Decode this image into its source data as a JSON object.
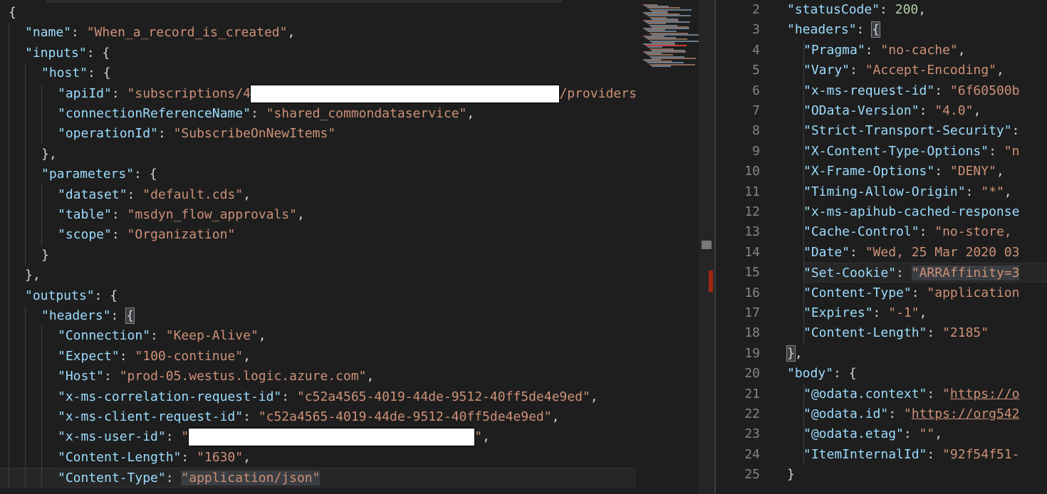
{
  "left_editor": {
    "lines": [
      [
        [
          "p",
          "{"
        ]
      ],
      [
        [
          "k",
          "\"name\""
        ],
        [
          "p",
          ": "
        ],
        [
          "s",
          "\"When_a_record_is_created\""
        ],
        [
          "p",
          ","
        ]
      ],
      [
        [
          "k",
          "\"inputs\""
        ],
        [
          "p",
          ": {"
        ]
      ],
      [
        [
          "k",
          "\"host\""
        ],
        [
          "p",
          ": {"
        ]
      ],
      [
        [
          "k",
          "\"apiId\""
        ],
        [
          "p",
          ": "
        ],
        [
          "s",
          "\"subscriptions/4"
        ],
        [
          "r",
          "                                        "
        ],
        [
          "s",
          "/providers/"
        ]
      ],
      [
        [
          "k",
          "\"connectionReferenceName\""
        ],
        [
          "p",
          ": "
        ],
        [
          "s",
          "\"shared_commondataservice\""
        ],
        [
          "p",
          ","
        ]
      ],
      [
        [
          "k",
          "\"operationId\""
        ],
        [
          "p",
          ": "
        ],
        [
          "s",
          "\"SubscribeOnNewItems\""
        ]
      ],
      [
        [
          "p",
          "},"
        ]
      ],
      [
        [
          "k",
          "\"parameters\""
        ],
        [
          "p",
          ": {"
        ]
      ],
      [
        [
          "k",
          "\"dataset\""
        ],
        [
          "p",
          ": "
        ],
        [
          "s",
          "\"default.cds\""
        ],
        [
          "p",
          ","
        ]
      ],
      [
        [
          "k",
          "\"table\""
        ],
        [
          "p",
          ": "
        ],
        [
          "s",
          "\"msdyn_flow_approvals\""
        ],
        [
          "p",
          ","
        ]
      ],
      [
        [
          "k",
          "\"scope\""
        ],
        [
          "p",
          ": "
        ],
        [
          "s",
          "\"Organization\""
        ]
      ],
      [
        [
          "p",
          "}"
        ]
      ],
      [
        [
          "p",
          "},"
        ]
      ],
      [
        [
          "k",
          "\"outputs\""
        ],
        [
          "p",
          ": {"
        ]
      ],
      [
        [
          "k",
          "\"headers\""
        ],
        [
          "p",
          ": "
        ],
        [
          "b",
          "{"
        ]
      ],
      [
        [
          "k",
          "\"Connection\""
        ],
        [
          "p",
          ": "
        ],
        [
          "s",
          "\"Keep-Alive\""
        ],
        [
          "p",
          ","
        ]
      ],
      [
        [
          "k",
          "\"Expect\""
        ],
        [
          "p",
          ": "
        ],
        [
          "s",
          "\"100-continue\""
        ],
        [
          "p",
          ","
        ]
      ],
      [
        [
          "k",
          "\"Host\""
        ],
        [
          "p",
          ": "
        ],
        [
          "s",
          "\"prod-05.westus.logic.azure.com\""
        ],
        [
          "p",
          ","
        ]
      ],
      [
        [
          "k",
          "\"x-ms-correlation-request-id\""
        ],
        [
          "p",
          ": "
        ],
        [
          "s",
          "\"c52a4565-4019-44de-9512-40ff5de4e9ed\""
        ],
        [
          "p",
          ","
        ]
      ],
      [
        [
          "k",
          "\"x-ms-client-request-id\""
        ],
        [
          "p",
          ": "
        ],
        [
          "s",
          "\"c52a4565-4019-44de-9512-40ff5de4e9ed\""
        ],
        [
          "p",
          ","
        ]
      ],
      [
        [
          "k",
          "\"x-ms-user-id\""
        ],
        [
          "p",
          ": "
        ],
        [
          "s",
          "\""
        ],
        [
          "r",
          "                                     "
        ],
        [
          "s",
          "\""
        ],
        [
          "p",
          ","
        ]
      ],
      [
        [
          "k",
          "\"Content-Length\""
        ],
        [
          "p",
          ": "
        ],
        [
          "s",
          "\"1630\""
        ],
        [
          "p",
          ","
        ]
      ],
      [
        [
          "k",
          "\"Content-Type\""
        ],
        [
          "p",
          ": "
        ],
        [
          "sel",
          "\"application/json\""
        ]
      ]
    ]
  },
  "right_editor": {
    "line_numbers": [
      "2",
      "3",
      "4",
      "5",
      "6",
      "7",
      "8",
      "9",
      "10",
      "11",
      "12",
      "13",
      "14",
      "15",
      "16",
      "17",
      "18",
      "19",
      "20",
      "21",
      "22",
      "23",
      "24",
      "25"
    ],
    "lines": [
      [
        [
          "k",
          "\"statusCode\""
        ],
        [
          "p",
          ": "
        ],
        [
          "n",
          "200"
        ],
        [
          "p",
          ","
        ]
      ],
      [
        [
          "k",
          "\"headers\""
        ],
        [
          "p",
          ": "
        ],
        [
          "b",
          "{"
        ]
      ],
      [
        [
          "k",
          "\"Pragma\""
        ],
        [
          "p",
          ": "
        ],
        [
          "s",
          "\"no-cache\""
        ],
        [
          "p",
          ","
        ]
      ],
      [
        [
          "k",
          "\"Vary\""
        ],
        [
          "p",
          ": "
        ],
        [
          "s",
          "\"Accept-Encoding\""
        ],
        [
          "p",
          ","
        ]
      ],
      [
        [
          "k",
          "\"x-ms-request-id\""
        ],
        [
          "p",
          ": "
        ],
        [
          "s",
          "\"6f60500b"
        ]
      ],
      [
        [
          "k",
          "\"OData-Version\""
        ],
        [
          "p",
          ": "
        ],
        [
          "s",
          "\"4.0\""
        ],
        [
          "p",
          ","
        ]
      ],
      [
        [
          "k",
          "\"Strict-Transport-Security\""
        ],
        [
          "p",
          ":"
        ]
      ],
      [
        [
          "k",
          "\"X-Content-Type-Options\""
        ],
        [
          "p",
          ": "
        ],
        [
          "s",
          "\"n"
        ]
      ],
      [
        [
          "k",
          "\"X-Frame-Options\""
        ],
        [
          "p",
          ": "
        ],
        [
          "s",
          "\"DENY\""
        ],
        [
          "p",
          ","
        ]
      ],
      [
        [
          "k",
          "\"Timing-Allow-Origin\""
        ],
        [
          "p",
          ": "
        ],
        [
          "s",
          "\"*\""
        ],
        [
          "p",
          ","
        ]
      ],
      [
        [
          "k",
          "\"x-ms-apihub-cached-response"
        ]
      ],
      [
        [
          "k",
          "\"Cache-Control\""
        ],
        [
          "p",
          ": "
        ],
        [
          "s",
          "\"no-store,"
        ]
      ],
      [
        [
          "k",
          "\"Date\""
        ],
        [
          "p",
          ": "
        ],
        [
          "s",
          "\"Wed, 25 Mar 2020 03"
        ]
      ],
      [
        [
          "k",
          "\"Set-Cookie\""
        ],
        [
          "p",
          ": "
        ],
        [
          "sel",
          "\"ARRAffinity=3"
        ]
      ],
      [
        [
          "k",
          "\"Content-Type\""
        ],
        [
          "p",
          ": "
        ],
        [
          "s",
          "\"application"
        ]
      ],
      [
        [
          "k",
          "\"Expires\""
        ],
        [
          "p",
          ": "
        ],
        [
          "s",
          "\"-1\""
        ],
        [
          "p",
          ","
        ]
      ],
      [
        [
          "k",
          "\"Content-Length\""
        ],
        [
          "p",
          ": "
        ],
        [
          "s",
          "\"2185\""
        ]
      ],
      [
        [
          "b",
          "}"
        ],
        [
          "p",
          ","
        ]
      ],
      [
        [
          "k",
          "\"body\""
        ],
        [
          "p",
          ": {"
        ]
      ],
      [
        [
          "k",
          "\"@odata.context\""
        ],
        [
          "p",
          ": "
        ],
        [
          "s",
          "\""
        ],
        [
          "u",
          "https://o"
        ]
      ],
      [
        [
          "k",
          "\"@odata.id\""
        ],
        [
          "p",
          ": "
        ],
        [
          "s",
          "\""
        ],
        [
          "u",
          "https://org542"
        ]
      ],
      [
        [
          "k",
          "\"@odata.etag\""
        ],
        [
          "p",
          ": "
        ],
        [
          "s",
          "\"\""
        ],
        [
          "p",
          ","
        ]
      ],
      [
        [
          "k",
          "\"ItemInternalId\""
        ],
        [
          "p",
          ": "
        ],
        [
          "s",
          "\"92f54f51-"
        ]
      ],
      [
        [
          "p",
          "}"
        ]
      ]
    ]
  },
  "colors": {
    "background": "#1e1e1e",
    "key": "#9cdcfe",
    "string": "#ce9178",
    "number": "#b5cea8",
    "punctuation": "#d4d4d4",
    "line_number": "#858585"
  }
}
